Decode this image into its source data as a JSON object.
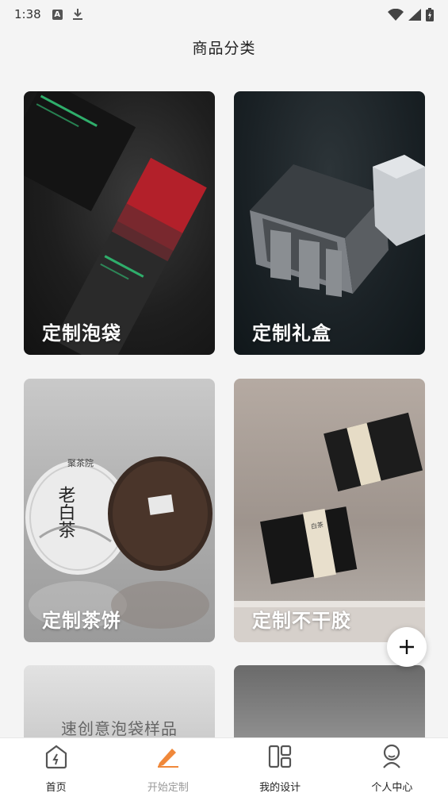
{
  "status_bar": {
    "time": "1:38",
    "a_icon_letter": "A"
  },
  "header": {
    "title": "商品分类"
  },
  "cards": [
    {
      "label": "定制泡袋",
      "image": "tea-bag-packaging-photo"
    },
    {
      "label": "定制礼盒",
      "image": "gift-box-photo"
    },
    {
      "label": "定制茶饼",
      "image": "tea-cake-photo"
    },
    {
      "label": "定制不干胶",
      "image": "sticker-packaging-photo"
    },
    {
      "overlay_text": "速创意泡袋样品",
      "image": "sample-bag-photo"
    },
    {
      "image": "dark-gray-photo"
    }
  ],
  "card3_art": {
    "brand": "聚茶院",
    "cake_name": "老白茶"
  },
  "card4_art": {
    "box_label": "白茶"
  },
  "fab": {
    "icon": "plus-icon"
  },
  "bottom_nav": [
    {
      "label": "首页",
      "icon": "home-icon"
    },
    {
      "label": "开始定制",
      "icon": "pencil-icon"
    },
    {
      "label": "我的设计",
      "icon": "layout-icon"
    },
    {
      "label": "个人中心",
      "icon": "person-icon"
    }
  ],
  "colors": {
    "accent": "#f0883a",
    "background": "#f4f4f4",
    "nav_inactive": "#999999"
  }
}
